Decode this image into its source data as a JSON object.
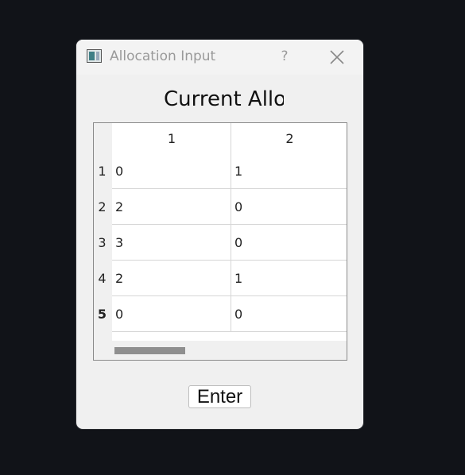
{
  "window": {
    "title": "Allocation Input",
    "help_label": "?",
    "icons": {
      "app": "app-window-icon",
      "close": "close-icon"
    }
  },
  "heading": "Current Alloc",
  "table": {
    "column_headers": [
      "1",
      "2"
    ],
    "row_headers": [
      "1",
      "2",
      "3",
      "4",
      "5"
    ],
    "rows": [
      [
        "0",
        "1"
      ],
      [
        "2",
        "0"
      ],
      [
        "3",
        "0"
      ],
      [
        "2",
        "1"
      ],
      [
        "0",
        "0"
      ]
    ],
    "current_row": "5"
  },
  "enter_label": "Enter",
  "colors": {
    "desktop": "#111318",
    "dialog": "#f0f0f0",
    "grid": "#d6d6d6",
    "scroll_thumb": "#8f8f8f"
  }
}
